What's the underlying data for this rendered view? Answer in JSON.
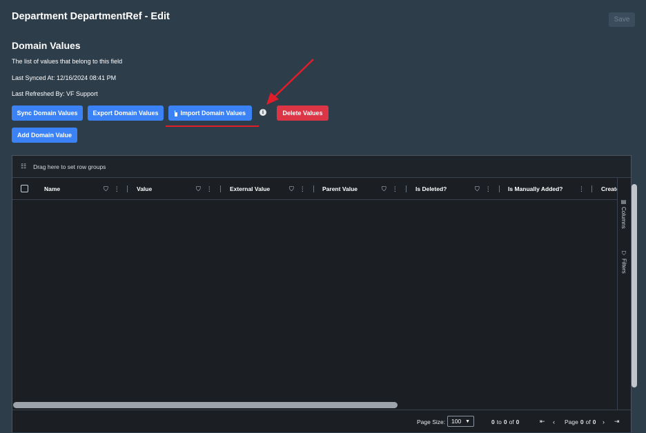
{
  "page": {
    "title": "Department DepartmentRef - Edit",
    "save_label": "Save"
  },
  "section": {
    "title": "Domain Values",
    "description": "The list of values that belong to this field",
    "last_synced": "Last Synced At: 12/16/2024 08:41 PM",
    "last_refreshed": "Last Refreshed By: VF Support"
  },
  "actions": {
    "sync": "Sync Domain Values",
    "export": "Export Domain Values",
    "import": "Import Domain Values",
    "delete": "Delete Values",
    "add": "Add Domain Value"
  },
  "grid": {
    "group_hint": "Drag here to set row groups",
    "columns": [
      {
        "label": "Name"
      },
      {
        "label": "Value"
      },
      {
        "label": "External Value"
      },
      {
        "label": "Parent Value"
      },
      {
        "label": "Is Deleted?"
      },
      {
        "label": "Is Manually Added?"
      },
      {
        "label": "Create"
      }
    ],
    "side_tabs": {
      "columns": "Columns",
      "filters": "Filters"
    },
    "footer": {
      "page_size_label": "Page Size:",
      "page_size_value": "100",
      "range_from": "0",
      "range_to_word": "to",
      "range_to": "0",
      "of_word": "of",
      "range_total": "0",
      "page_word": "Page",
      "page_current": "0",
      "page_of_word": "of",
      "page_total": "0"
    }
  },
  "colors": {
    "background": "#2e3d4a",
    "primary": "#3b82f6",
    "danger": "#dc3545",
    "grid_bg": "#1b1f24",
    "annotation": "#e11d2a"
  },
  "icons": [
    "info-icon",
    "file-icon",
    "filter-icon",
    "menu-icon",
    "columns-icon",
    "row-group-icon",
    "first-page-icon",
    "prev-page-icon",
    "next-page-icon",
    "last-page-icon"
  ]
}
